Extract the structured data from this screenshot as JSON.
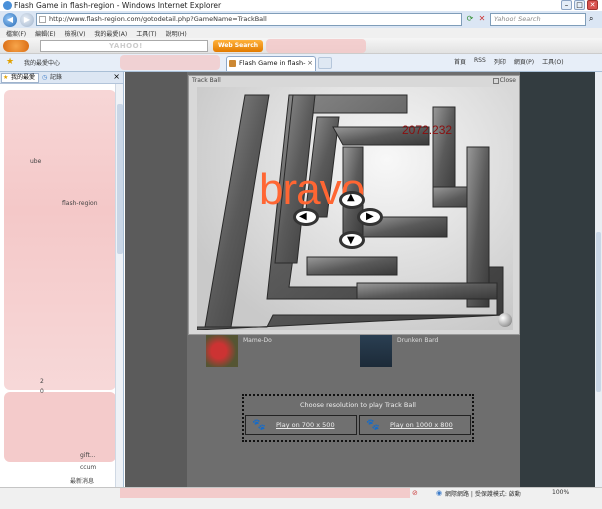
{
  "window": {
    "title": "Flash Game in flash-region - Windows Internet Explorer"
  },
  "address": {
    "url": "http://www.flash-region.com/gotodetail.php?GameName=TrackBall",
    "search_placeholder": "Yahoo! Search"
  },
  "menu": {
    "items": [
      "檔案(F)",
      "編輯(E)",
      "檢視(V)",
      "我的最愛(A)",
      "工具(T)",
      "說明(H)"
    ]
  },
  "yahoo_toolbar": {
    "logo_text": "YAHOO!",
    "web_search_label": "Web Search"
  },
  "tabbar": {
    "favorites_center_label": "我的最愛中心",
    "active_tab_label": "Flash Game in flash-re...",
    "commands": [
      "首頁",
      "RSS",
      "列印",
      "網頁(P)",
      "工具(O)"
    ]
  },
  "favorites_panel": {
    "tab_favorites": "我的最愛",
    "tab_history": "記錄",
    "visible_fragments": [
      "flash-region",
      "ube",
      "gift...",
      "ccum",
      "最新消息",
      "2",
      "0"
    ]
  },
  "game": {
    "window_title": "Track Ball",
    "close_label": "Close",
    "score": "2072.232",
    "message": "bravo"
  },
  "related_games": [
    {
      "name": "Mame-Do"
    },
    {
      "name": "Drunken Bard"
    }
  ],
  "resolution": {
    "title": "Choose resolution to play Track Ball",
    "option_small": "Play on 700 x 500",
    "option_large": "Play on 1000 x 800"
  },
  "statusbar": {
    "zone_text": "網際網路 | 受保護模式: 啟動",
    "zoom": "100%"
  }
}
